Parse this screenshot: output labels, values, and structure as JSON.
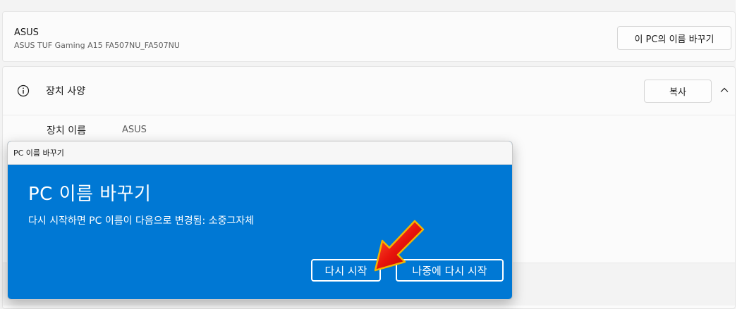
{
  "device": {
    "name": "ASUS",
    "model": "ASUS TUF Gaming A15 FA507NU_FA507NU",
    "rename_button": "이 PC의 이름 바꾸기"
  },
  "specs": {
    "title": "장치 사양",
    "copy_button": "복사",
    "icon": "info-icon",
    "collapse_icon": "chevron-up-icon",
    "rows": [
      {
        "label": "장치 이름",
        "value": "ASUS"
      }
    ]
  },
  "dialog": {
    "titlebar": "PC 이름 바꾸기",
    "heading": "PC 이름 바꾸기",
    "message": "다시 시작하면 PC 이름이 다음으로 변경됨: 소중그자체",
    "restart_button": "다시 시작",
    "later_button": "나중에 다시 시작",
    "accent_color": "#0078d4"
  },
  "annotation": {
    "icon": "red-arrow-icon",
    "color": "#e8140c"
  }
}
